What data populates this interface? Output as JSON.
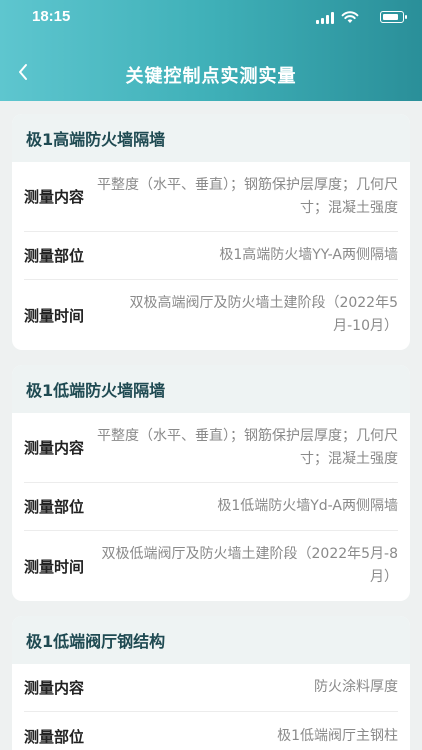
{
  "status_bar": {
    "time": "18:15"
  },
  "nav": {
    "title": "关键控制点实测实量"
  },
  "cards": [
    {
      "title": "极1高端防火墙隔墙",
      "rows": [
        {
          "label": "测量内容",
          "value": "平整度（水平、垂直）；钢筋保护层厚度；几何尺寸；混凝土强度"
        },
        {
          "label": "测量部位",
          "value": "极1高端防火墙YY-A两侧隔墙"
        },
        {
          "label": "测量时间",
          "value": "双极高端阀厅及防火墙土建阶段（2022年5月-10月）"
        }
      ]
    },
    {
      "title": "极1低端防火墙隔墙",
      "rows": [
        {
          "label": "测量内容",
          "value": "平整度（水平、垂直）；钢筋保护层厚度；几何尺寸；混凝土强度"
        },
        {
          "label": "测量部位",
          "value": "极1低端防火墙Yd-A两侧隔墙"
        },
        {
          "label": "测量时间",
          "value": "双极低端阀厅及防火墙土建阶段（2022年5月-8月）"
        }
      ]
    },
    {
      "title": "极1低端阀厅钢结构",
      "rows": [
        {
          "label": "测量内容",
          "value": "防火涂料厚度"
        },
        {
          "label": "测量部位",
          "value": "极1低端阀厅主钢柱"
        }
      ]
    }
  ]
}
